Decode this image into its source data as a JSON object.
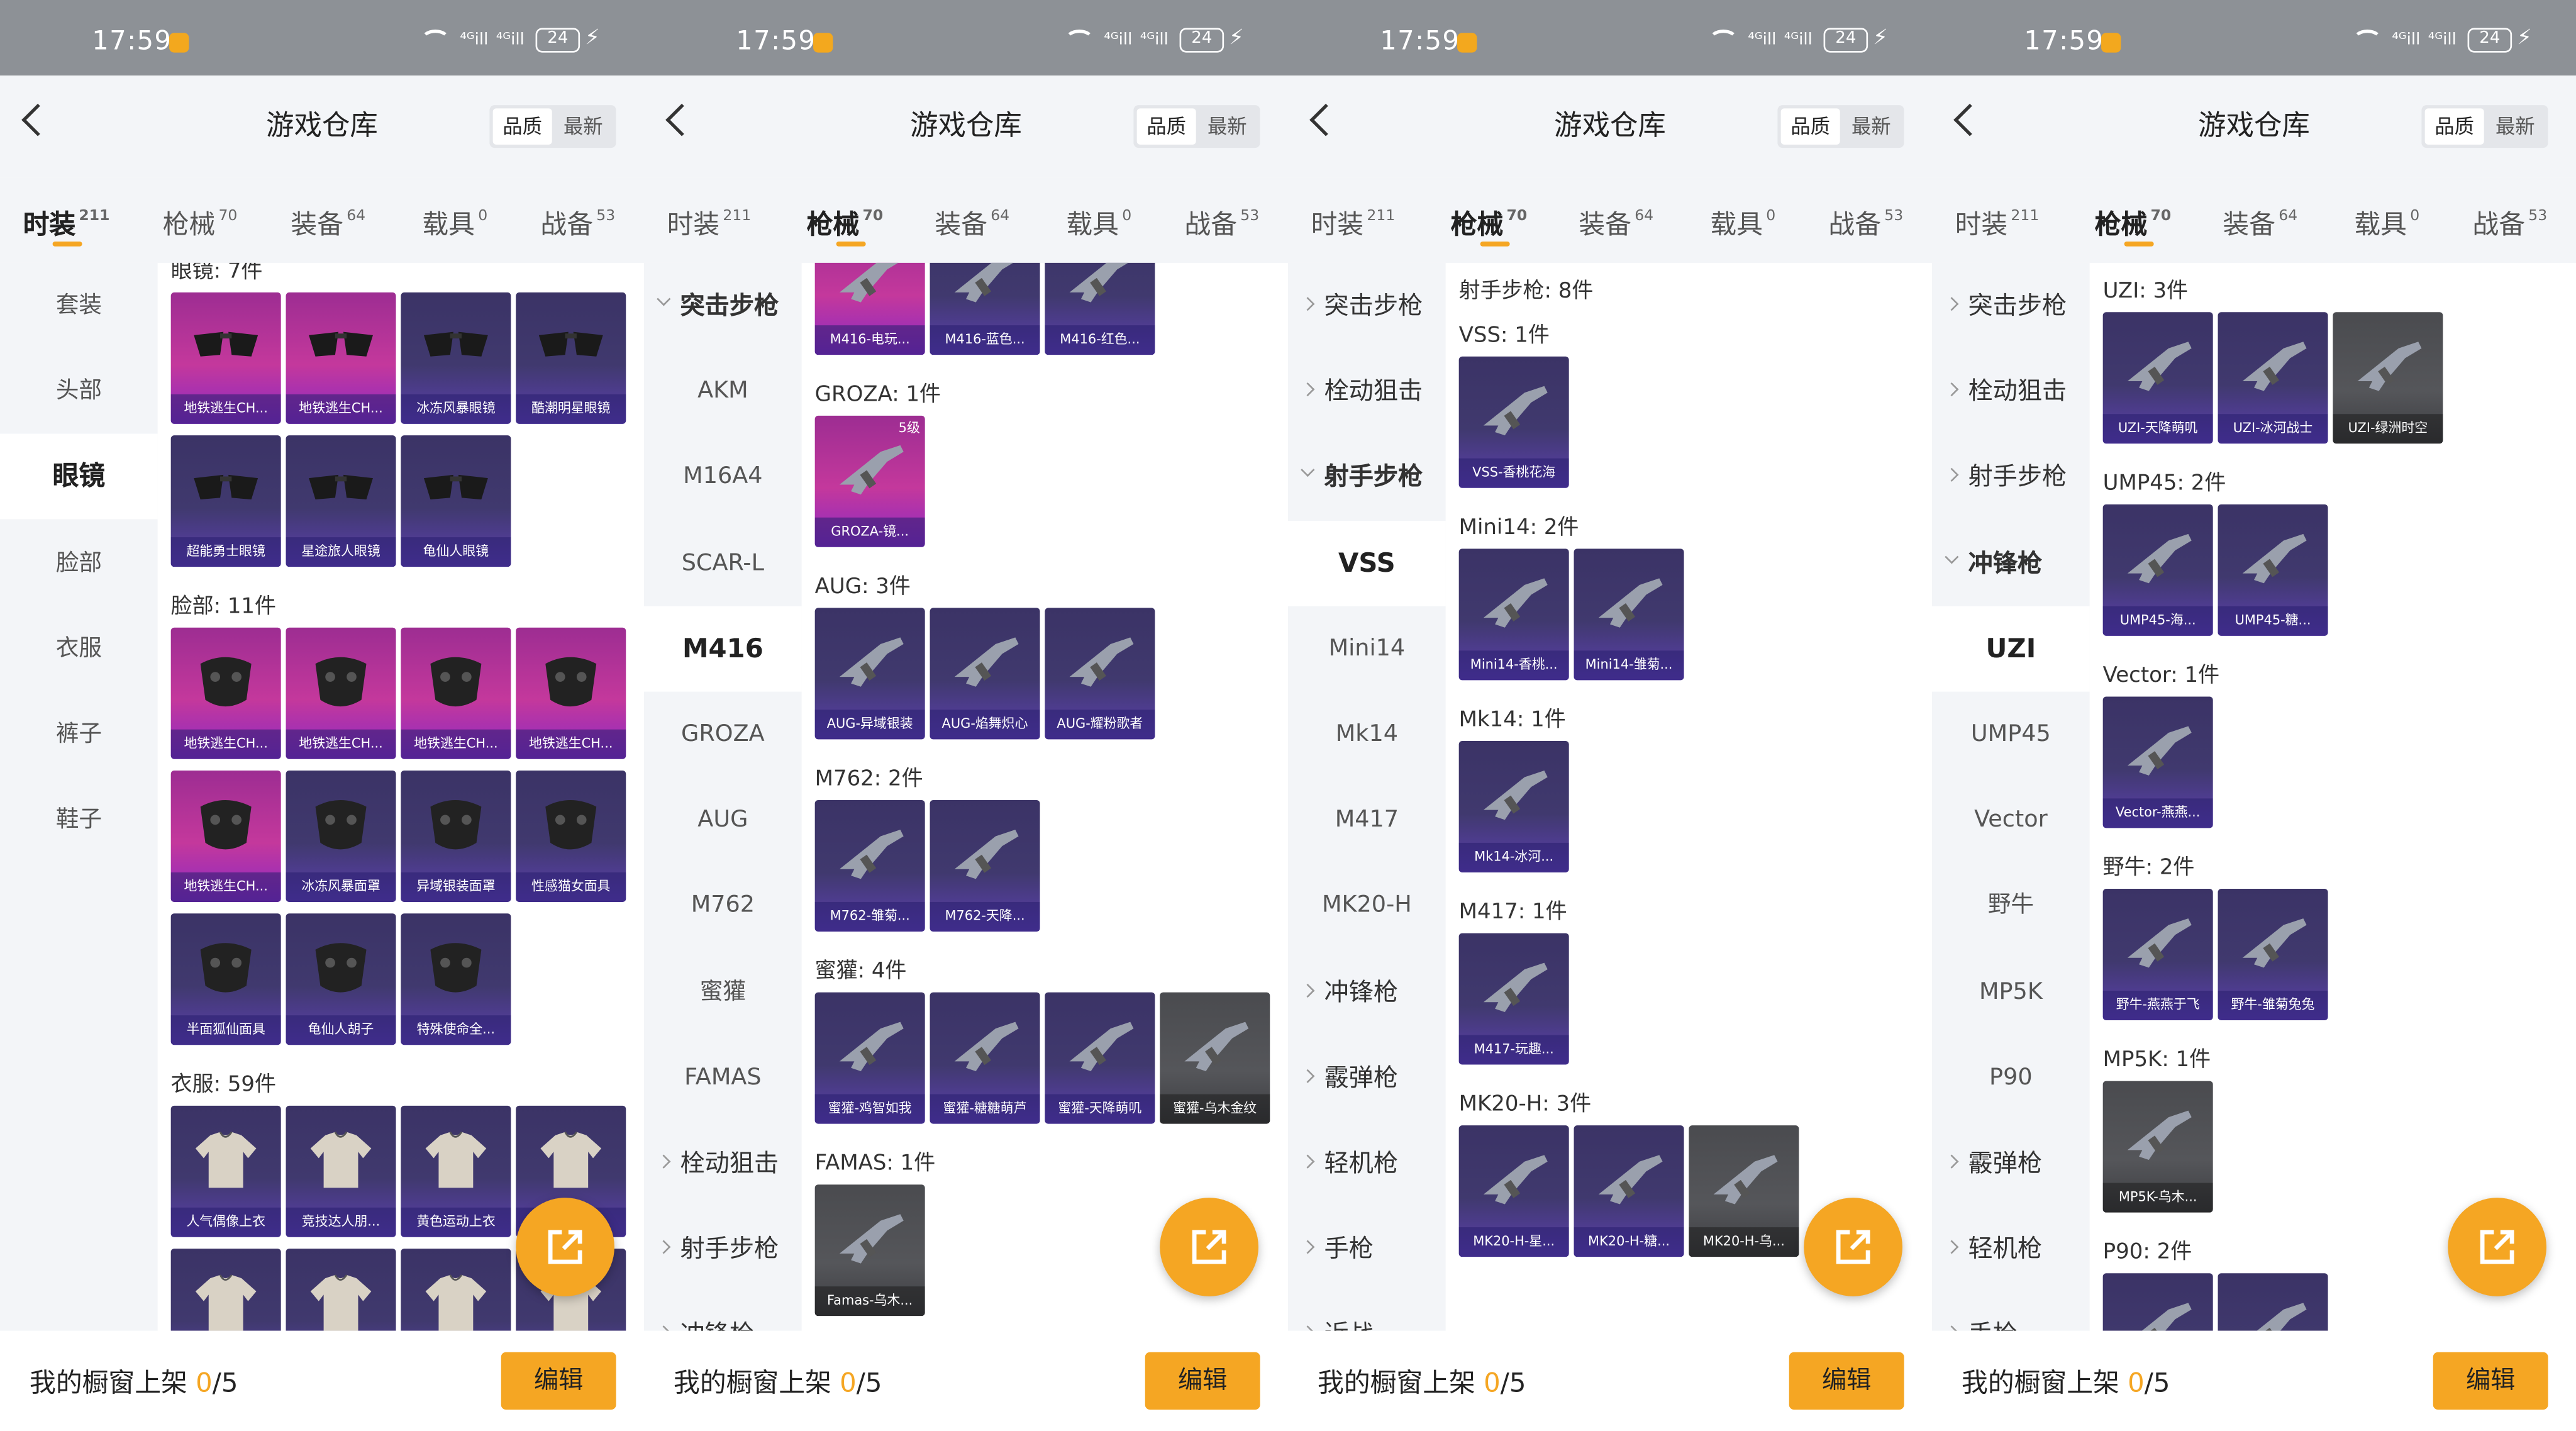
{
  "status_bar": {
    "time": "17:59",
    "battery": "24",
    "signal_1": "⁴ᴳill",
    "signal_2": "⁴ᴳill"
  },
  "header": {
    "title": "游戏仓库",
    "back_icon": "chevron-left-icon",
    "sort_quality": "品质",
    "sort_newest": "最新"
  },
  "tabs": [
    {
      "label": "时装",
      "count": "211"
    },
    {
      "label": "枪械",
      "count": "70"
    },
    {
      "label": "装备",
      "count": "64"
    },
    {
      "label": "载具",
      "count": "0"
    },
    {
      "label": "战备",
      "count": "53"
    }
  ],
  "colors": {
    "accent": "#f5a623",
    "card_purple": "#40396e",
    "card_pink": "#c4389c",
    "card_gray": "#55565a",
    "panel_bg": "#f3f5f8"
  },
  "panels": [
    {
      "active_tab": 0,
      "sidebar": [
        {
          "label": "套装",
          "kind": "plain"
        },
        {
          "label": "头部",
          "kind": "plain"
        },
        {
          "label": "眼镜",
          "kind": "selected"
        },
        {
          "label": "脸部",
          "kind": "plain"
        },
        {
          "label": "衣服",
          "kind": "plain"
        },
        {
          "label": "裤子",
          "kind": "plain"
        },
        {
          "label": "鞋子",
          "kind": "plain"
        }
      ],
      "sections": [
        {
          "title": "眼镜: 7件",
          "items": [
            {
              "name": "地铁逃生CH...",
              "bg": "pink",
              "icon": "glasses"
            },
            {
              "name": "地铁逃生CH...",
              "bg": "pink",
              "icon": "glasses"
            },
            {
              "name": "冰冻风暴眼镜",
              "bg": "purple",
              "icon": "glasses"
            },
            {
              "name": "酷潮明星眼镜",
              "bg": "purple",
              "icon": "glasses"
            },
            {
              "name": "超能勇士眼镜",
              "bg": "purple",
              "icon": "glasses"
            },
            {
              "name": "星途旅人眼镜",
              "bg": "purple",
              "icon": "glasses"
            },
            {
              "name": "龟仙人眼镜",
              "bg": "purple",
              "icon": "glasses"
            }
          ]
        },
        {
          "title": "脸部: 11件",
          "items": [
            {
              "name": "地铁逃生CH...",
              "bg": "pink",
              "icon": "mask"
            },
            {
              "name": "地铁逃生CH...",
              "bg": "pink",
              "icon": "mask"
            },
            {
              "name": "地铁逃生CH...",
              "bg": "pink",
              "icon": "mask"
            },
            {
              "name": "地铁逃生CH...",
              "bg": "pink",
              "icon": "mask"
            },
            {
              "name": "地铁逃生CH...",
              "bg": "pink",
              "icon": "mask"
            },
            {
              "name": "冰冻风暴面罩",
              "bg": "purple",
              "icon": "mask"
            },
            {
              "name": "异域银装面罩",
              "bg": "purple",
              "icon": "mask"
            },
            {
              "name": "性感猫女面具",
              "bg": "purple",
              "icon": "mask"
            },
            {
              "name": "半面狐仙面具",
              "bg": "purple",
              "icon": "mask"
            },
            {
              "name": "龟仙人胡子",
              "bg": "purple",
              "icon": "mask"
            },
            {
              "name": "特殊使命全...",
              "bg": "purple",
              "icon": "mask"
            }
          ]
        },
        {
          "title": "衣服: 59件",
          "items": [
            {
              "name": "人气偶像上衣",
              "bg": "purple",
              "icon": "shirt"
            },
            {
              "name": "竞技达人朋...",
              "bg": "purple",
              "icon": "shirt"
            },
            {
              "name": "黄色运动上衣",
              "bg": "purple",
              "icon": "shirt"
            },
            {
              "name": "",
              "bg": "purple",
              "icon": "shirt"
            },
            {
              "name": "",
              "bg": "purple",
              "icon": "shirt"
            },
            {
              "name": "",
              "bg": "purple",
              "icon": "shirt"
            },
            {
              "name": "",
              "bg": "purple",
              "icon": "shirt"
            },
            {
              "name": "",
              "bg": "purple",
              "icon": "shirt"
            }
          ]
        }
      ]
    },
    {
      "active_tab": 1,
      "sidebar": [
        {
          "label": "突击步枪",
          "kind": "open"
        },
        {
          "label": "AKM",
          "kind": "plain"
        },
        {
          "label": "M16A4",
          "kind": "plain"
        },
        {
          "label": "SCAR-L",
          "kind": "plain"
        },
        {
          "label": "M416",
          "kind": "selected"
        },
        {
          "label": "GROZA",
          "kind": "plain"
        },
        {
          "label": "AUG",
          "kind": "plain"
        },
        {
          "label": "M762",
          "kind": "plain"
        },
        {
          "label": "蜜獾",
          "kind": "plain"
        },
        {
          "label": "FAMAS",
          "kind": "plain"
        },
        {
          "label": "栓动狙击",
          "kind": "closed"
        },
        {
          "label": "射手步枪",
          "kind": "closed"
        },
        {
          "label": "冲锋枪",
          "kind": "closed"
        }
      ],
      "sections": [
        {
          "title": "",
          "items": [
            {
              "name": "M416-电玩...",
              "bg": "pink",
              "icon": "gun"
            },
            {
              "name": "M416-蓝色...",
              "bg": "purple",
              "icon": "gun"
            },
            {
              "name": "M416-红色...",
              "bg": "purple",
              "icon": "gun"
            }
          ]
        },
        {
          "title": "GROZA: 1件",
          "items": [
            {
              "name": "GROZA-镜...",
              "bg": "pink",
              "icon": "gun",
              "level": "5级"
            }
          ]
        },
        {
          "title": "AUG: 3件",
          "items": [
            {
              "name": "AUG-异域银装",
              "bg": "purple",
              "icon": "gun"
            },
            {
              "name": "AUG-焰舞炽心",
              "bg": "purple",
              "icon": "gun"
            },
            {
              "name": "AUG-耀粉歌者",
              "bg": "purple",
              "icon": "gun"
            }
          ]
        },
        {
          "title": "M762: 2件",
          "items": [
            {
              "name": "M762-雏菊...",
              "bg": "purple",
              "icon": "gun"
            },
            {
              "name": "M762-天降...",
              "bg": "purple",
              "icon": "gun"
            }
          ]
        },
        {
          "title": "蜜獾: 4件",
          "items": [
            {
              "name": "蜜獾-鸡智如我",
              "bg": "purple",
              "icon": "gun"
            },
            {
              "name": "蜜獾-糖糖萌芦",
              "bg": "purple",
              "icon": "gun"
            },
            {
              "name": "蜜獾-天降萌叽",
              "bg": "purple",
              "icon": "gun"
            },
            {
              "name": "蜜獾-乌木金纹",
              "bg": "gray",
              "icon": "gun"
            }
          ]
        },
        {
          "title": "FAMAS: 1件",
          "items": [
            {
              "name": "Famas-乌木...",
              "bg": "gray",
              "icon": "gun"
            }
          ]
        }
      ]
    },
    {
      "active_tab": 1,
      "sidebar": [
        {
          "label": "突击步枪",
          "kind": "closed"
        },
        {
          "label": "栓动狙击",
          "kind": "closed"
        },
        {
          "label": "射手步枪",
          "kind": "open"
        },
        {
          "label": "VSS",
          "kind": "selected"
        },
        {
          "label": "Mini14",
          "kind": "plain"
        },
        {
          "label": "Mk14",
          "kind": "plain"
        },
        {
          "label": "M417",
          "kind": "plain"
        },
        {
          "label": "MK20-H",
          "kind": "plain"
        },
        {
          "label": "冲锋枪",
          "kind": "closed"
        },
        {
          "label": "霰弹枪",
          "kind": "closed"
        },
        {
          "label": "轻机枪",
          "kind": "closed"
        },
        {
          "label": "手枪",
          "kind": "closed"
        },
        {
          "label": "近战",
          "kind": "closed"
        }
      ],
      "heading": "射手步枪: 8件",
      "sections": [
        {
          "title": "VSS: 1件",
          "items": [
            {
              "name": "VSS-香桃花海",
              "bg": "purple",
              "icon": "gun"
            }
          ]
        },
        {
          "title": "Mini14: 2件",
          "items": [
            {
              "name": "Mini14-香桃...",
              "bg": "purple",
              "icon": "gun"
            },
            {
              "name": "Mini14-雏菊...",
              "bg": "purple",
              "icon": "gun"
            }
          ]
        },
        {
          "title": "Mk14: 1件",
          "items": [
            {
              "name": "Mk14-冰河...",
              "bg": "purple",
              "icon": "gun"
            }
          ]
        },
        {
          "title": "M417: 1件",
          "items": [
            {
              "name": "M417-玩趣...",
              "bg": "purple",
              "icon": "gun"
            }
          ]
        },
        {
          "title": "MK20-H: 3件",
          "items": [
            {
              "name": "MK20-H-星...",
              "bg": "purple",
              "icon": "gun"
            },
            {
              "name": "MK20-H-糖...",
              "bg": "purple",
              "icon": "gun"
            },
            {
              "name": "MK20-H-乌...",
              "bg": "gray",
              "icon": "gun"
            }
          ]
        }
      ]
    },
    {
      "active_tab": 1,
      "sidebar": [
        {
          "label": "突击步枪",
          "kind": "closed"
        },
        {
          "label": "栓动狙击",
          "kind": "closed"
        },
        {
          "label": "射手步枪",
          "kind": "closed"
        },
        {
          "label": "冲锋枪",
          "kind": "open"
        },
        {
          "label": "UZI",
          "kind": "selected"
        },
        {
          "label": "UMP45",
          "kind": "plain"
        },
        {
          "label": "Vector",
          "kind": "plain"
        },
        {
          "label": "野牛",
          "kind": "plain"
        },
        {
          "label": "MP5K",
          "kind": "plain"
        },
        {
          "label": "P90",
          "kind": "plain"
        },
        {
          "label": "霰弹枪",
          "kind": "closed"
        },
        {
          "label": "轻机枪",
          "kind": "closed"
        },
        {
          "label": "手枪",
          "kind": "closed"
        }
      ],
      "sections": [
        {
          "title": "UZI: 3件",
          "items": [
            {
              "name": "UZI-天降萌叽",
              "bg": "purple",
              "icon": "gun"
            },
            {
              "name": "UZI-冰河战士",
              "bg": "purple",
              "icon": "gun"
            },
            {
              "name": "UZI-绿洲时空",
              "bg": "gray",
              "icon": "gun"
            }
          ]
        },
        {
          "title": "UMP45: 2件",
          "items": [
            {
              "name": "UMP45-海...",
              "bg": "purple",
              "icon": "gun"
            },
            {
              "name": "UMP45-糖...",
              "bg": "purple",
              "icon": "gun"
            }
          ]
        },
        {
          "title": "Vector: 1件",
          "items": [
            {
              "name": "Vector-燕燕...",
              "bg": "purple",
              "icon": "gun"
            }
          ]
        },
        {
          "title": "野牛: 2件",
          "items": [
            {
              "name": "野牛-燕燕于飞",
              "bg": "purple",
              "icon": "gun"
            },
            {
              "name": "野牛-雏菊兔兔",
              "bg": "purple",
              "icon": "gun"
            }
          ]
        },
        {
          "title": "MP5K: 1件",
          "items": [
            {
              "name": "MP5K-乌木...",
              "bg": "gray",
              "icon": "gun"
            }
          ]
        },
        {
          "title": "P90: 2件",
          "items": [
            {
              "name": "",
              "bg": "purple",
              "icon": "gun"
            },
            {
              "name": "",
              "bg": "purple",
              "icon": "gun"
            }
          ]
        }
      ]
    }
  ],
  "bottom": {
    "label": "我的橱窗上架",
    "count": "0",
    "total": "/5",
    "edit_label": "编辑"
  },
  "fab_icon": "share-external-icon"
}
